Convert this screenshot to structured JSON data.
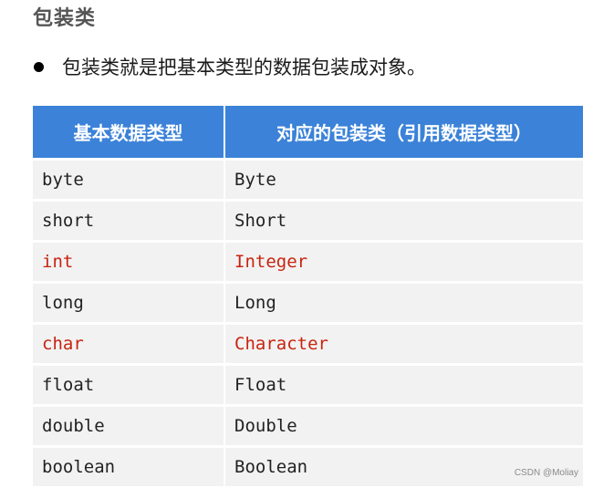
{
  "title": "包装类",
  "bullet_text": "包装类就是把基本类型的数据包装成对象。",
  "table": {
    "headers": [
      "基本数据类型",
      "对应的包装类（引用数据类型）"
    ],
    "rows": [
      {
        "primitive": "byte",
        "wrapper": "Byte",
        "highlight": false
      },
      {
        "primitive": "short",
        "wrapper": "Short",
        "highlight": false
      },
      {
        "primitive": "int",
        "wrapper": "Integer",
        "highlight": true
      },
      {
        "primitive": "long",
        "wrapper": "Long",
        "highlight": false
      },
      {
        "primitive": "char",
        "wrapper": "Character",
        "highlight": true
      },
      {
        "primitive": "float",
        "wrapper": "Float",
        "highlight": false
      },
      {
        "primitive": "double",
        "wrapper": "Double",
        "highlight": false
      },
      {
        "primitive": "boolean",
        "wrapper": "Boolean",
        "highlight": false
      }
    ]
  },
  "colors": {
    "header_bg": "#3b82d8",
    "highlight_text": "#c8240f",
    "row_bg": "#f2f2f2"
  },
  "watermark": "CSDN @Moliay"
}
